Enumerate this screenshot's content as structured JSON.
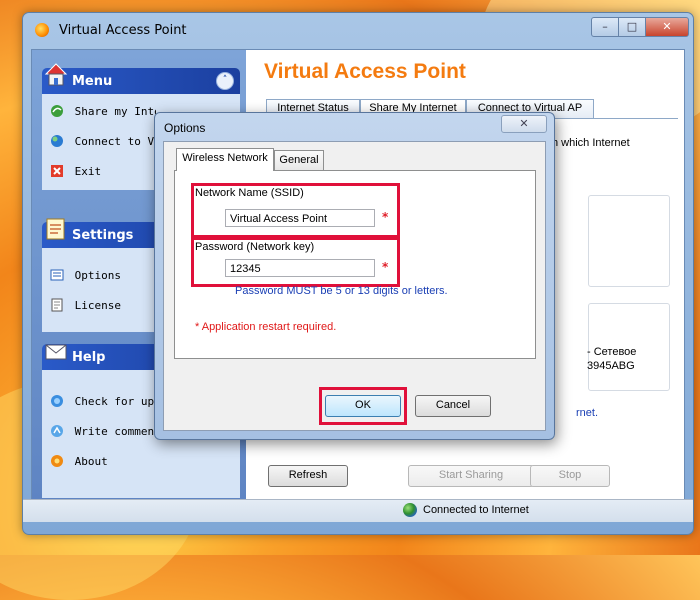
{
  "window": {
    "title": "Virtual Access Point",
    "min": "–",
    "max": "□",
    "close": "✕"
  },
  "sidebar": {
    "menu": {
      "title": "Menu",
      "items": [
        {
          "label": "Share my Internet",
          "icon": "share-icon"
        },
        {
          "label": "Connect to Virtual AP",
          "icon": "connect-icon"
        },
        {
          "label": "Exit",
          "icon": "exit-icon"
        }
      ]
    },
    "settings": {
      "title": "Settings",
      "items": [
        {
          "label": "Options",
          "icon": "options-icon"
        },
        {
          "label": "License",
          "icon": "license-icon"
        }
      ]
    },
    "help": {
      "title": "Help",
      "items": [
        {
          "label": "Check for updates",
          "icon": "update-icon"
        },
        {
          "label": "Write comments",
          "icon": "comments-icon"
        },
        {
          "label": "About",
          "icon": "about-icon"
        }
      ]
    },
    "collapse_glyph": "˄"
  },
  "main": {
    "app_title": "Virtual Access Point",
    "tabs": [
      {
        "label": "Internet Status"
      },
      {
        "label": "Share My Internet"
      },
      {
        "label": "Connect to Virtual AP"
      }
    ],
    "fragments": {
      "which_internet": "h which Internet",
      "adapter_name": "- Сетевое",
      "adapter_id": "3945ABG",
      "net_suffix": "rnet."
    },
    "buttons": {
      "refresh": "Refresh",
      "start": "Start Sharing",
      "stop": "Stop"
    }
  },
  "status": {
    "text": "Connected to Internet"
  },
  "dialog": {
    "title": "Options",
    "close": "✕",
    "tabs": [
      {
        "label": "Wireless Network"
      },
      {
        "label": "General"
      }
    ],
    "ssid_label": "Network Name (SSID)",
    "ssid_value": "Virtual Access Point",
    "password_label": "Password (Network key)",
    "password_value": "12345",
    "required_mark": "*",
    "hint": "Password MUST be 5 or 13 digits or letters.",
    "restart_note": "* Application restart required.",
    "ok": "OK",
    "cancel": "Cancel"
  },
  "colors": {
    "accent": "#f47b10",
    "required": "#e0103a",
    "hint": "#1a3fb4"
  }
}
